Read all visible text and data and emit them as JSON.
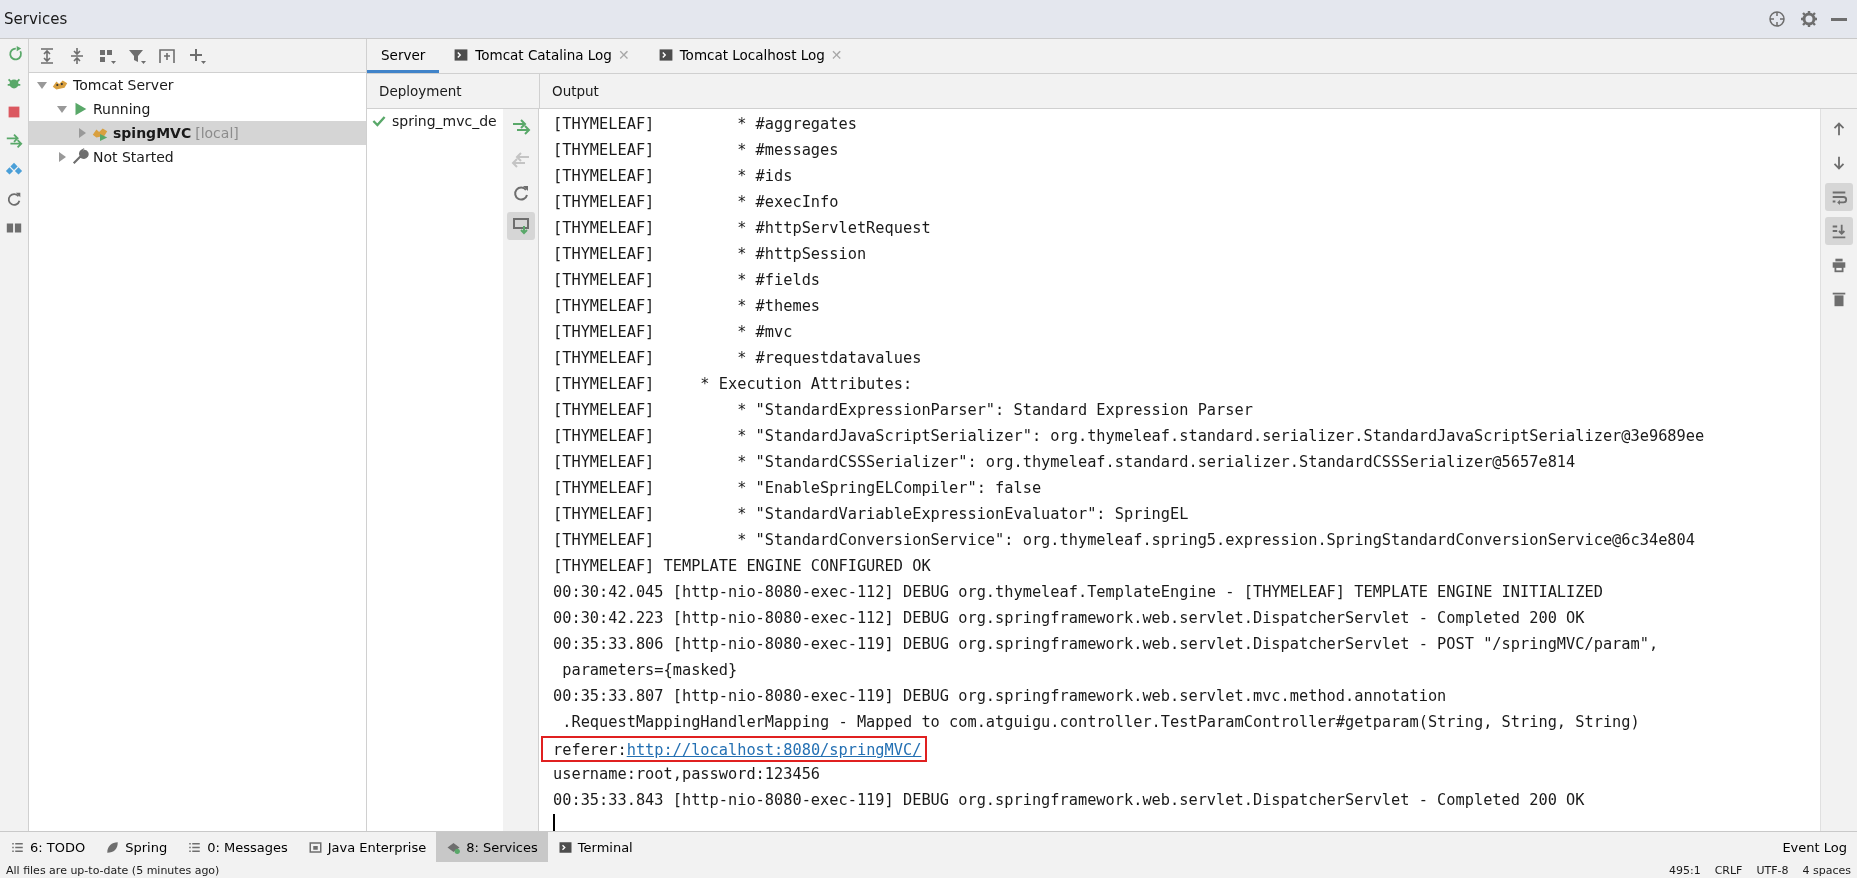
{
  "window": {
    "title": "Services"
  },
  "side_actions": [
    {
      "kind": "rerun"
    },
    {
      "kind": "debug"
    },
    {
      "kind": "stop"
    },
    {
      "kind": "deploy"
    },
    {
      "kind": "diamond"
    },
    {
      "kind": "refresh"
    },
    {
      "kind": "layout"
    }
  ],
  "tree_toolbar": [
    {
      "kind": "expand"
    },
    {
      "kind": "collapse"
    },
    {
      "kind": "group"
    },
    {
      "kind": "filter"
    },
    {
      "kind": "new-tab"
    },
    {
      "kind": "add"
    }
  ],
  "tree": [
    {
      "kind": "server",
      "label": "Tomcat Server",
      "expanded": true,
      "selected": false,
      "children": [
        {
          "kind": "running",
          "label": "Running",
          "expanded": true,
          "selected": false,
          "children": [
            {
              "kind": "app",
              "label": "spingMVC",
              "suffix": "[local]",
              "expanded": false,
              "selected": true
            }
          ]
        },
        {
          "kind": "stopped",
          "label": "Not Started",
          "expanded": false,
          "selected": false
        }
      ]
    }
  ],
  "tabs": [
    {
      "label": "Server",
      "kind": "plain",
      "selected": true
    },
    {
      "label": "Tomcat Catalina Log",
      "kind": "console",
      "selected": false,
      "close": "✕"
    },
    {
      "label": "Tomcat Localhost Log",
      "kind": "console",
      "selected": false,
      "close": "✕"
    }
  ],
  "deployment": {
    "header": "Deployment",
    "items": [
      {
        "label": "spring_mvc_de",
        "deployed": true
      }
    ],
    "actions": [
      {
        "kind": "deploy",
        "disabled": false,
        "on": false
      },
      {
        "kind": "undeploy",
        "disabled": true,
        "on": false
      },
      {
        "kind": "refresh",
        "disabled": false,
        "on": false
      },
      {
        "kind": "update",
        "disabled": false,
        "on": true
      }
    ]
  },
  "output": {
    "header": "Output",
    "lines": [
      {
        "text": "[THYMELEAF]         * #aggregates"
      },
      {
        "text": "[THYMELEAF]         * #messages"
      },
      {
        "text": "[THYMELEAF]         * #ids"
      },
      {
        "text": "[THYMELEAF]         * #execInfo"
      },
      {
        "text": "[THYMELEAF]         * #httpServletRequest"
      },
      {
        "text": "[THYMELEAF]         * #httpSession"
      },
      {
        "text": "[THYMELEAF]         * #fields"
      },
      {
        "text": "[THYMELEAF]         * #themes"
      },
      {
        "text": "[THYMELEAF]         * #mvc"
      },
      {
        "text": "[THYMELEAF]         * #requestdatavalues"
      },
      {
        "text": "[THYMELEAF]     * Execution Attributes:"
      },
      {
        "text": "[THYMELEAF]         * \"StandardExpressionParser\": Standard Expression Parser"
      },
      {
        "text": "[THYMELEAF]         * \"StandardJavaScriptSerializer\": org.thymeleaf.standard.serializer.StandardJavaScriptSerializer@3e9689ee"
      },
      {
        "text": "[THYMELEAF]         * \"StandardCSSSerializer\": org.thymeleaf.standard.serializer.StandardCSSSerializer@5657e814"
      },
      {
        "text": "[THYMELEAF]         * \"EnableSpringELCompiler\": false"
      },
      {
        "text": "[THYMELEAF]         * \"StandardVariableExpressionEvaluator\": SpringEL"
      },
      {
        "text": "[THYMELEAF]         * \"StandardConversionService\": org.thymeleaf.spring5.expression.SpringStandardConversionService@6c34e804"
      },
      {
        "text": "[THYMELEAF] TEMPLATE ENGINE CONFIGURED OK"
      },
      {
        "text": "00:30:42.045 [http-nio-8080-exec-112] DEBUG org.thymeleaf.TemplateEngine - [THYMELEAF] TEMPLATE ENGINE INITIALIZED"
      },
      {
        "text": "00:30:42.223 [http-nio-8080-exec-112] DEBUG org.springframework.web.servlet.DispatcherServlet - Completed 200 OK"
      },
      {
        "text": "00:35:33.806 [http-nio-8080-exec-119] DEBUG org.springframework.web.servlet.DispatcherServlet - POST \"/springMVC/param\","
      },
      {
        "text": " parameters={masked}"
      },
      {
        "text": "00:35:33.807 [http-nio-8080-exec-119] DEBUG org.springframework.web.servlet.mvc.method.annotation"
      },
      {
        "text": " .RequestMappingHandlerMapping - Mapped to com.atguigu.controller.TestParamController#getparam(String, String, String)"
      },
      {
        "text": "referer:",
        "link": "http://localhost:8080/springMVC/",
        "highlighted": true
      },
      {
        "text": "username:root,password:123456"
      },
      {
        "text": "00:35:33.843 [http-nio-8080-exec-119] DEBUG org.springframework.web.servlet.DispatcherServlet - Completed 200 OK"
      }
    ]
  },
  "output_toolbar": [
    {
      "kind": "up",
      "on": false
    },
    {
      "kind": "down",
      "on": false
    },
    {
      "kind": "wrap",
      "on": true
    },
    {
      "kind": "scroll-end",
      "on": true
    },
    {
      "kind": "print",
      "on": false
    },
    {
      "kind": "trash",
      "on": false
    }
  ],
  "tool_windows": [
    {
      "label": "6: TODO",
      "kind": "list",
      "selected": false
    },
    {
      "label": "Spring",
      "kind": "leaf",
      "selected": false
    },
    {
      "label": "0: Messages",
      "kind": "list",
      "selected": false
    },
    {
      "label": "Java Enterprise",
      "kind": "cup",
      "selected": false
    },
    {
      "label": "8: Services",
      "kind": "services",
      "selected": true
    },
    {
      "label": "Terminal",
      "kind": "console",
      "selected": false
    }
  ],
  "event_log": "Event Log",
  "status_bar": {
    "message": "All files are up-to-date (5 minutes ago)",
    "items": [
      "495:1",
      "CRLF",
      "UTF-8",
      "4 spaces"
    ]
  }
}
